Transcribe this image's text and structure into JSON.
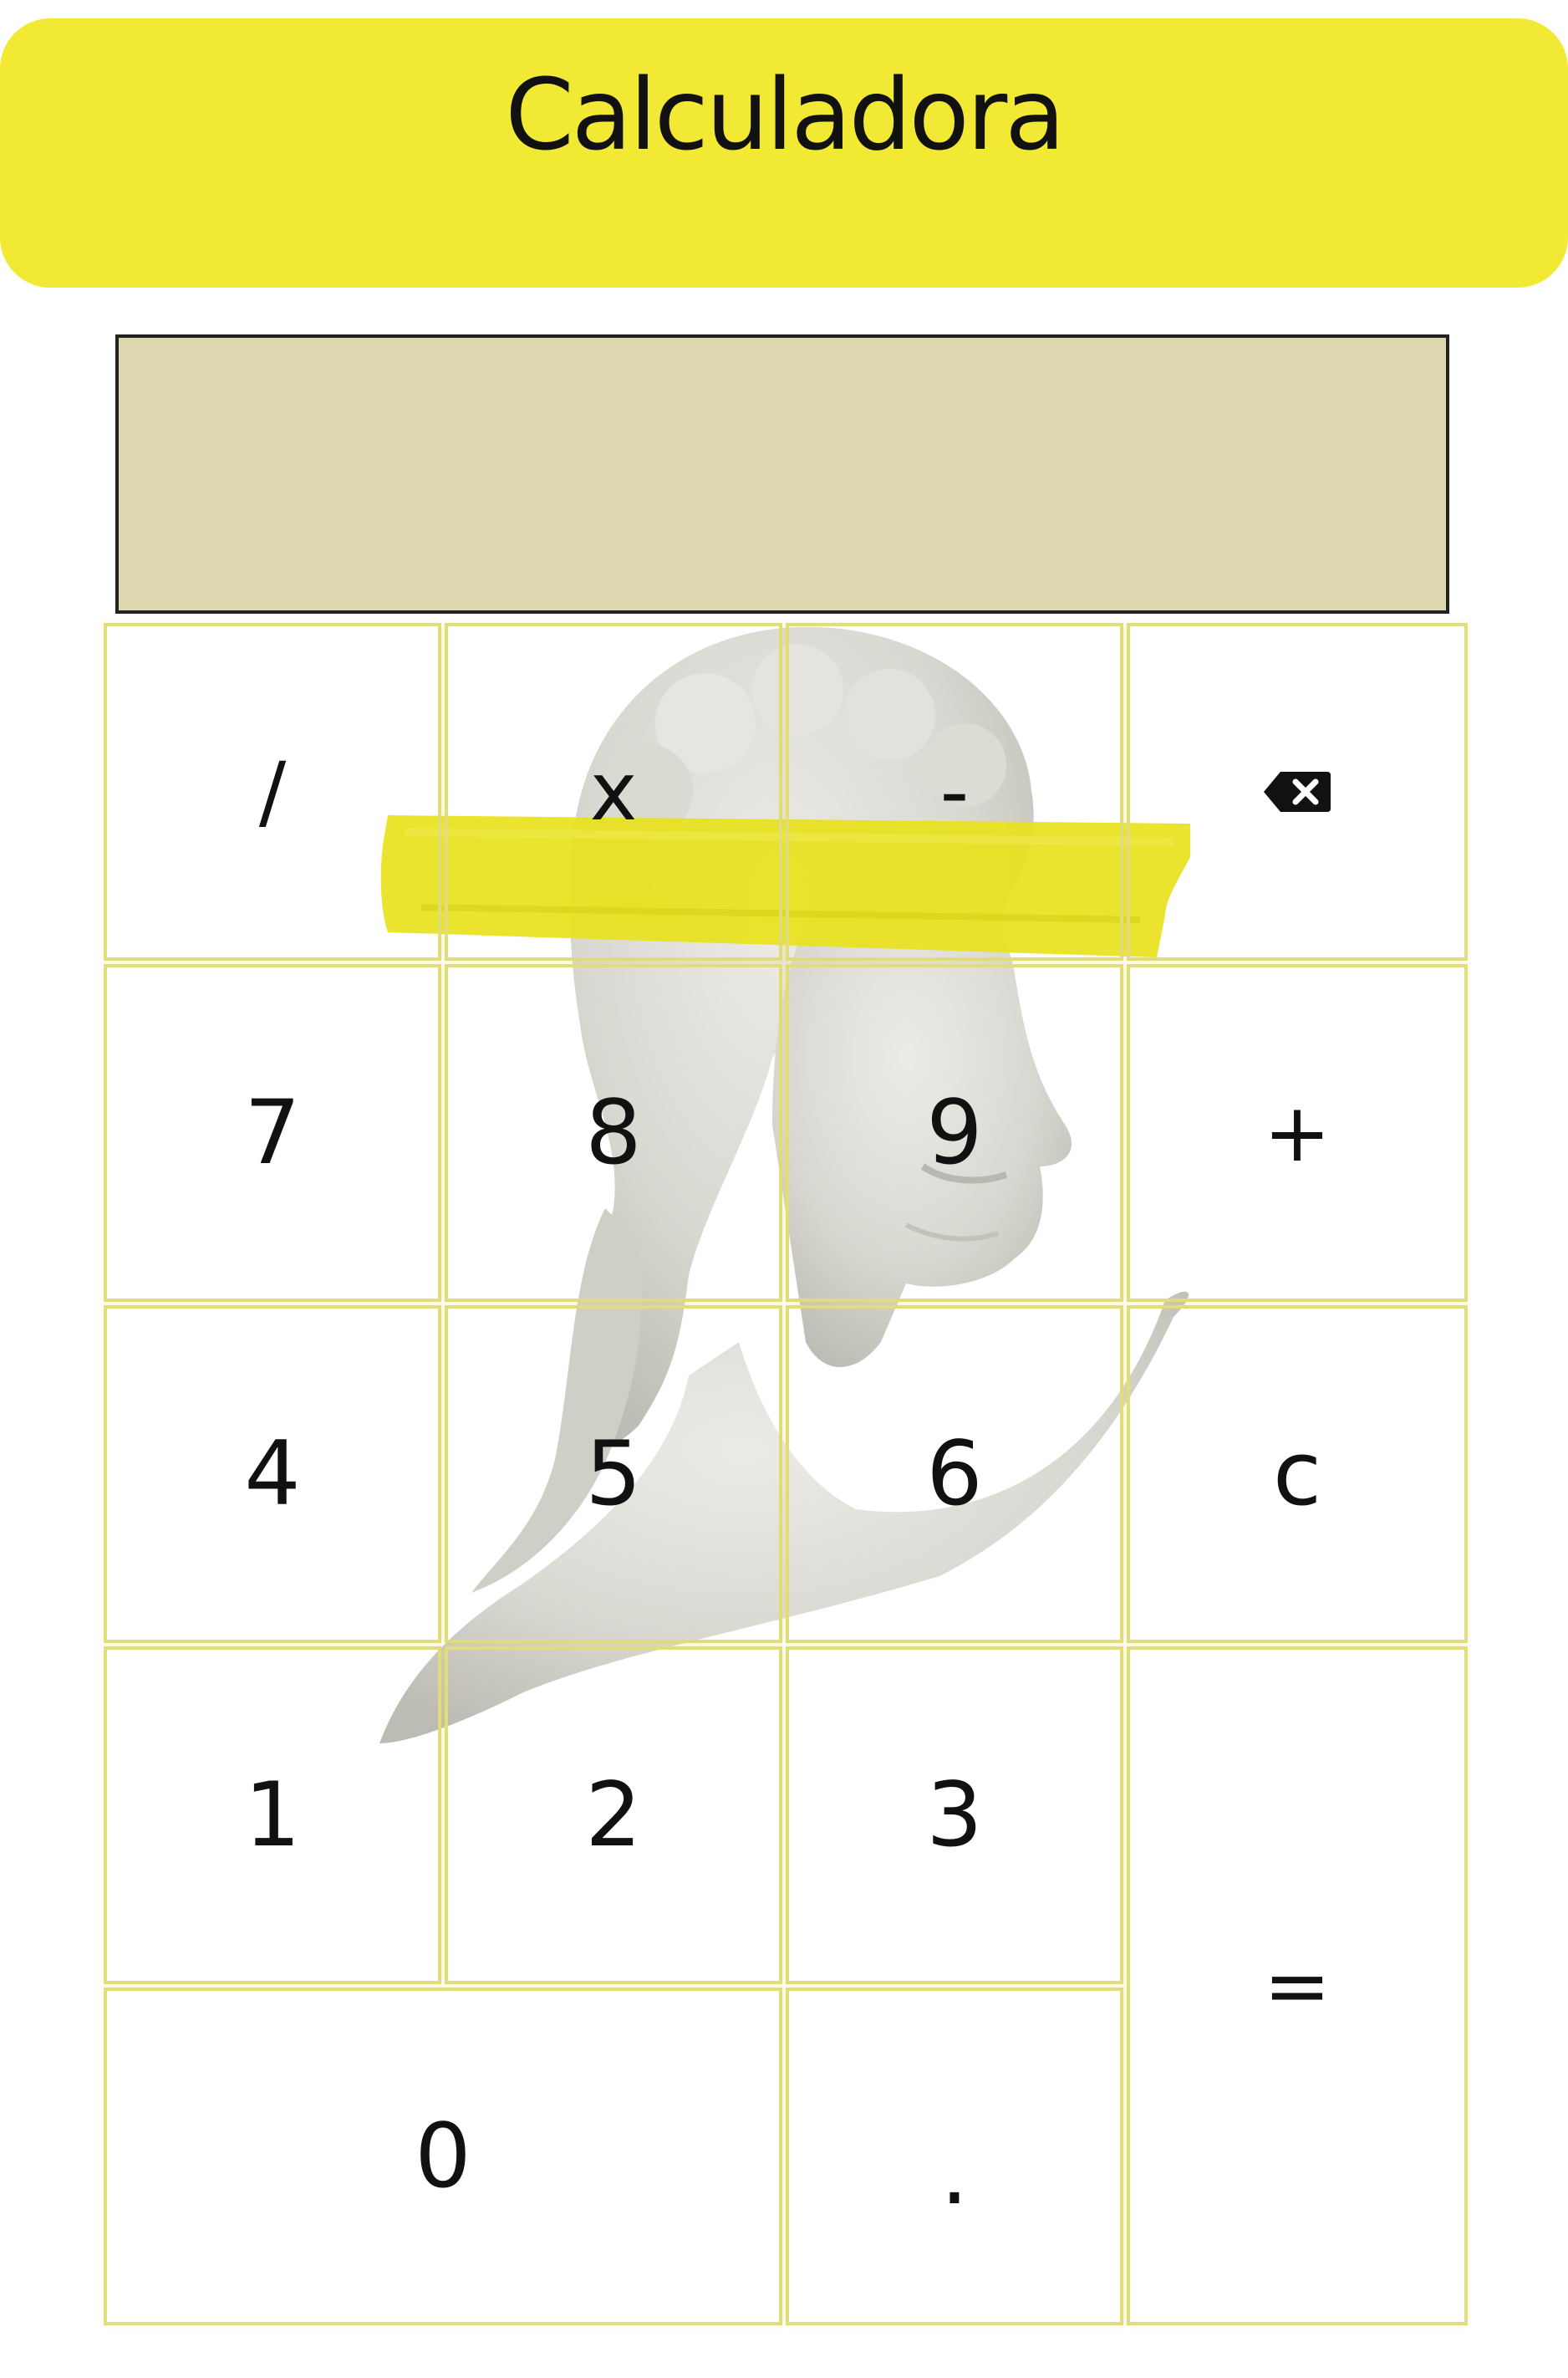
{
  "header": {
    "title": "Calculadora"
  },
  "display": {
    "value": ""
  },
  "keys": {
    "divide": "/",
    "multiply": "x",
    "subtract": "-",
    "backspace_icon": "backspace-icon",
    "seven": "7",
    "eight": "8",
    "nine": "9",
    "add": "+",
    "four": "4",
    "five": "5",
    "six": "6",
    "clear": "c",
    "one": "1",
    "two": "2",
    "three": "3",
    "equals": "=",
    "zero": "0",
    "decimal": "."
  },
  "colors": {
    "header_bg": "#f2e935",
    "display_bg": "#ddd6ae",
    "key_border": "#e1dc7c",
    "highlight_stroke": "#e8e21c"
  },
  "decoration": {
    "background_image": "statue-bust-image"
  }
}
